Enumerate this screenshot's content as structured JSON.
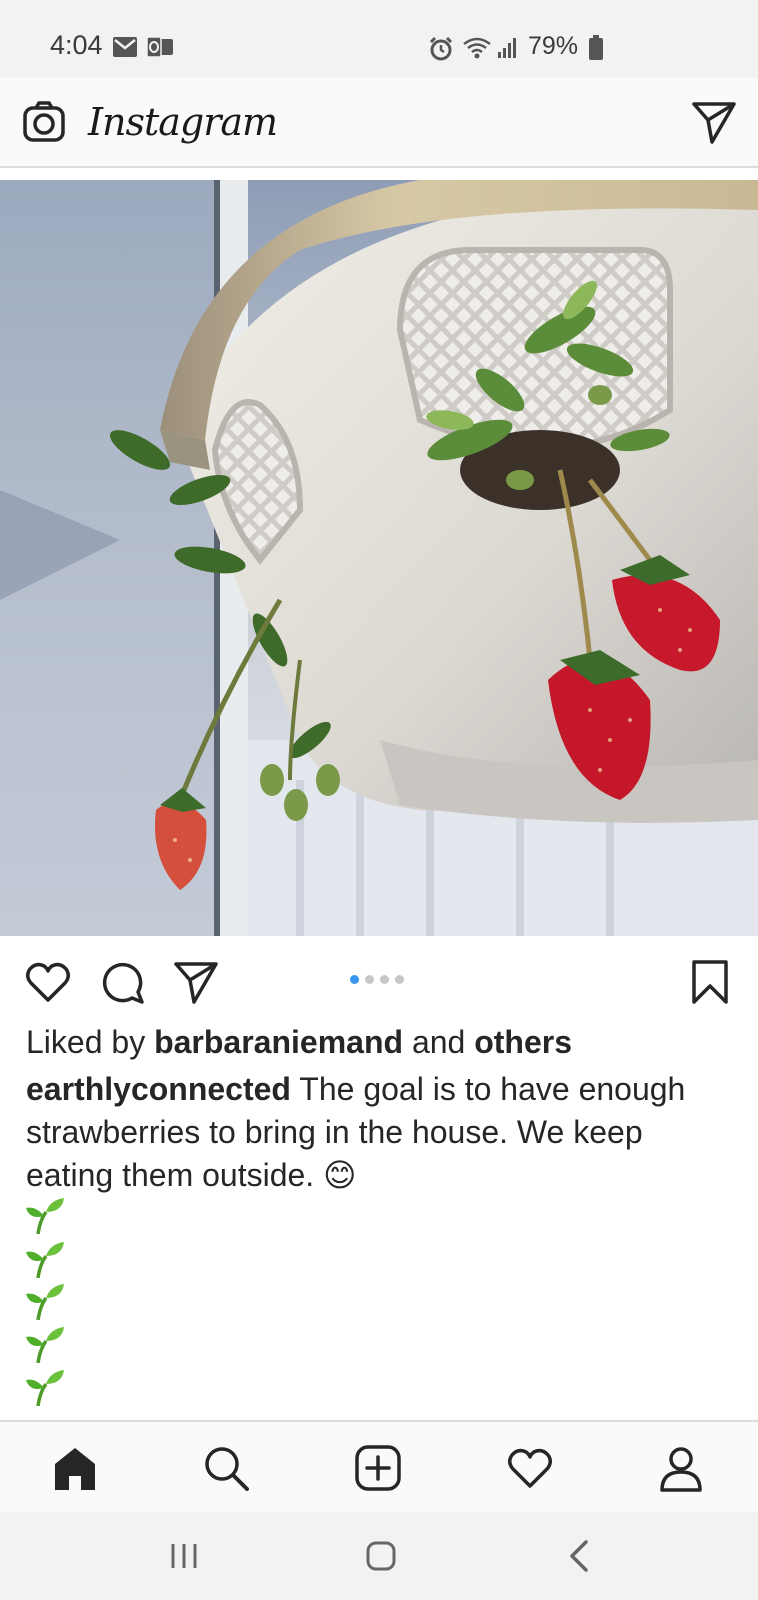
{
  "status_bar": {
    "time": "4:04",
    "battery_percent": "79%",
    "icons": [
      "gmail-icon",
      "outlook-icon",
      "alarm-icon",
      "wifi-icon",
      "signal-icon",
      "battery-icon"
    ]
  },
  "top_bar": {
    "brand": "Instagram",
    "icons": [
      "camera-icon",
      "direct-message-icon"
    ]
  },
  "post": {
    "image_description_icon": "strawberry-planter-photo",
    "carousel": {
      "count": 4,
      "active_index": 0,
      "active_color": "#3897f0",
      "inactive_color": "#c7c7c7"
    },
    "actions": [
      "like-icon",
      "comment-icon",
      "share-icon",
      "save-icon"
    ],
    "likes": {
      "prefix": "Liked by",
      "user": "barbaraniemand",
      "conjunction": "and",
      "others": "others"
    },
    "caption": {
      "username": "earthlyconnected",
      "text": "The goal is to have enough strawberries to bring in the house. We keep eating them outside.",
      "emoji": "😊",
      "sprout_lines": 5
    }
  },
  "bottom_nav": {
    "items": [
      "home-icon",
      "search-icon",
      "new-post-icon",
      "activity-heart-icon",
      "profile-icon"
    ]
  },
  "system_nav": {
    "items": [
      "recents-icon",
      "home-button-icon",
      "back-icon"
    ]
  },
  "colors": {
    "text": "#262626",
    "accent": "#3897f0",
    "status_bg": "#f2f2f2",
    "bar_bg": "#fafafa"
  }
}
